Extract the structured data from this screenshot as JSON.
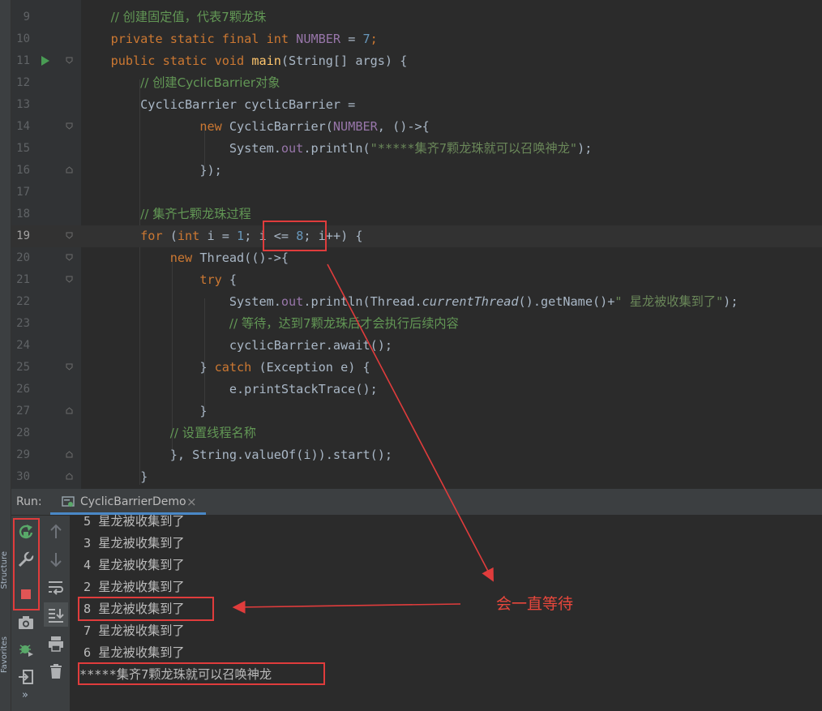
{
  "editor": {
    "lines": [
      {
        "n": "9"
      },
      {
        "n": "10"
      },
      {
        "n": "11"
      },
      {
        "n": "12"
      },
      {
        "n": "13"
      },
      {
        "n": "14"
      },
      {
        "n": "15"
      },
      {
        "n": "16"
      },
      {
        "n": "17"
      },
      {
        "n": "18"
      },
      {
        "n": "19"
      },
      {
        "n": "20"
      },
      {
        "n": "21"
      },
      {
        "n": "22"
      },
      {
        "n": "23"
      },
      {
        "n": "24"
      },
      {
        "n": "25"
      },
      {
        "n": "26"
      },
      {
        "n": "27"
      },
      {
        "n": "28"
      },
      {
        "n": "29"
      },
      {
        "n": "30"
      }
    ],
    "code": {
      "l9_cm": "// 创建固定值，代表7颗龙珠",
      "l10_a": "private static final int ",
      "l10_f": "NUMBER",
      "l10_b": " = ",
      "l10_n": "7",
      "l10_c": ";",
      "l11_a": "public static void ",
      "l11_m": "main",
      "l11_b": "(String[] args) {",
      "l12_cm": "// 创建CyclicBarrier对象",
      "l13": "CyclicBarrier cyclicBarrier =",
      "l14_k": "new ",
      "l14_c": "CyclicBarrier(",
      "l14_f": "NUMBER",
      "l14_e": ", ()->{",
      "l15_a": "System.",
      "l15_f": "out",
      "l15_b": ".",
      "l15_m": "println",
      "l15_c": "(",
      "l15_s": "\"*****集齐7颗龙珠就可以召唤神龙\"",
      "l15_d": ");",
      "l16": "});",
      "l18_cm": "// 集齐七颗龙珠过程",
      "l19_k": "for ",
      "l19_a": "(",
      "l19_k2": "int",
      "l19_b": " i = ",
      "l19_n1": "1",
      "l19_c": "; i <= ",
      "l19_n2": "8",
      "l19_d": "; i++) {",
      "l20_k": "new ",
      "l20_a": "Thread(()->{",
      "l21_k": "try",
      "l21_a": " {",
      "l22_a": "System.",
      "l22_f": "out",
      "l22_b": ".",
      "l22_m": "println",
      "l22_c": "(Thread.",
      "l22_m2": "currentThread",
      "l22_d": "().",
      "l22_m3": "getName",
      "l22_e": "()+",
      "l22_s": "\" 星龙被收集到了\"",
      "l22_g": ");",
      "l23_cm": "// 等待，达到7颗龙珠后才会执行后续内容",
      "l24_a": "cyclicBarrier.",
      "l24_m": "await",
      "l24_b": "();",
      "l25_a": "} ",
      "l25_k": "catch",
      "l25_b": " (Exception ",
      "l25_v": "e",
      "l25_c": ") {",
      "l26_a": "e.",
      "l26_m": "printStackTrace",
      "l26_b": "();",
      "l27": "}",
      "l28_cm": "// 设置线程名称",
      "l29_a": "}, String.",
      "l29_m": "valueOf",
      "l29_b": "(i)).",
      "l29_m2": "start",
      "l29_c": "();",
      "l30": "}"
    }
  },
  "side_tools": {
    "structure": "Structure",
    "favorites": "Favorites",
    "more": "»"
  },
  "run_panel": {
    "label": "Run:",
    "tab": "CyclicBarrierDemo",
    "tab_close": "×"
  },
  "console": {
    "lines": [
      "5 星龙被收集到了",
      "3 星龙被收集到了",
      "4 星龙被收集到了",
      "2 星龙被收集到了",
      "8 星龙被收集到了",
      "7 星龙被收集到了",
      "6 星龙被收集到了",
      "*****集齐7颗龙珠就可以召唤神龙"
    ]
  },
  "annotation": {
    "text": "会一直等待",
    "color": "#e03c3c"
  },
  "colors": {
    "keyword": "#cc7832",
    "comment": "#629755",
    "number": "#6897bb",
    "string": "#6a8759",
    "field": "#9876aa",
    "method": "#ffc66d",
    "run_tab_underline": "#4a88c7"
  }
}
